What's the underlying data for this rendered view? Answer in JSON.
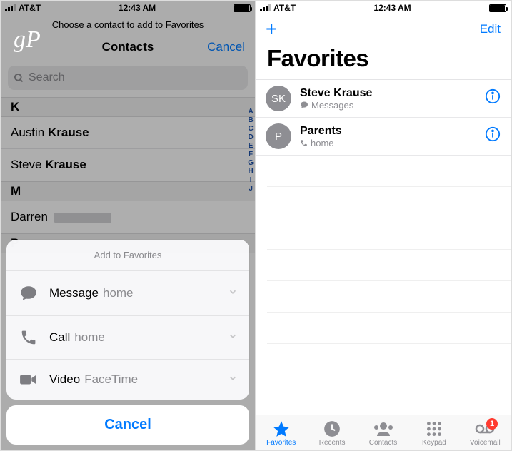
{
  "status": {
    "carrier": "AT&T",
    "time": "12:43 AM"
  },
  "left": {
    "watermark": "gP",
    "hint": "Choose a contact to add to Favorites",
    "nav_title": "Contacts",
    "nav_cancel": "Cancel",
    "search_placeholder": "Search",
    "sections": [
      {
        "letter": "K",
        "rows": [
          "Austin Krause",
          "Steve Krause"
        ]
      },
      {
        "letter": "M",
        "rows": [
          "Darren"
        ]
      },
      {
        "letter": "P",
        "rows": []
      }
    ],
    "index_letters": "ABCDEFGHIJ",
    "sheet": {
      "title": "Add to Favorites",
      "options": [
        {
          "icon": "message",
          "label": "Message",
          "sub": "home"
        },
        {
          "icon": "call",
          "label": "Call",
          "sub": "home"
        },
        {
          "icon": "video",
          "label": "Video",
          "sub": "FaceTime"
        }
      ],
      "cancel": "Cancel"
    }
  },
  "right": {
    "edit": "Edit",
    "title": "Favorites",
    "favorites": [
      {
        "initials": "SK",
        "name": "Steve Krause",
        "sub_icon": "message",
        "sub": "Messages"
      },
      {
        "initials": "P",
        "name": "Parents",
        "sub_icon": "call",
        "sub": "home"
      }
    ],
    "tabs": [
      {
        "id": "favorites",
        "label": "Favorites",
        "active": true
      },
      {
        "id": "recents",
        "label": "Recents"
      },
      {
        "id": "contacts",
        "label": "Contacts"
      },
      {
        "id": "keypad",
        "label": "Keypad"
      },
      {
        "id": "voicemail",
        "label": "Voicemail",
        "badge": "1"
      }
    ]
  }
}
